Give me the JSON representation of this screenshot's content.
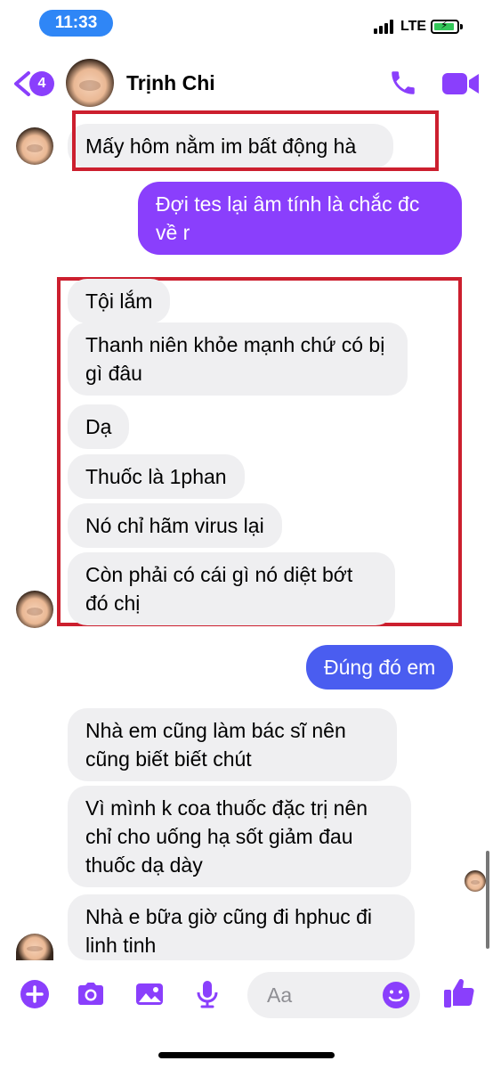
{
  "status": {
    "time": "11:33",
    "network": "LTE"
  },
  "header": {
    "back_badge": "4",
    "contact_name": "Trịnh Chi"
  },
  "messages": [
    {
      "text": "Mấy hôm nằm im bất động hà"
    },
    {
      "text": "Đợi tes lại âm tính là chắc đc về r"
    },
    {
      "text": "Tội lắm"
    },
    {
      "text": "Thanh niên khỏe mạnh chứ có bị gì đâu"
    },
    {
      "text": "Dạ"
    },
    {
      "text": "Thuốc là 1phan"
    },
    {
      "text": "Nó chỉ hãm virus lại"
    },
    {
      "text": "Còn phải có cái gì nó diệt bớt đó chị"
    },
    {
      "text": "Đúng đó em"
    },
    {
      "text": "Nhà em cũng làm bác sĩ nên cũng biết biết chút"
    },
    {
      "text": "Vì mình k coa thuốc đặc trị nên chỉ cho uống hạ sốt giảm đau thuốc dạ dày"
    },
    {
      "text": "Nhà e bữa giờ cũng đi hphuc đi linh tinh"
    }
  ],
  "composer": {
    "placeholder": "Aa"
  },
  "icons": [
    "back-chevron-icon",
    "phone-icon",
    "video-camera-icon",
    "plus-icon",
    "camera-icon",
    "image-icon",
    "microphone-icon",
    "emoji-icon",
    "thumbs-up-icon"
  ],
  "colors": {
    "accent": "#8a3ffc",
    "outgoing_blue": "#4a5df0",
    "incoming_bg": "#efeff1",
    "highlight_box": "#cc1f2e",
    "time_pill": "#2f86f6"
  }
}
